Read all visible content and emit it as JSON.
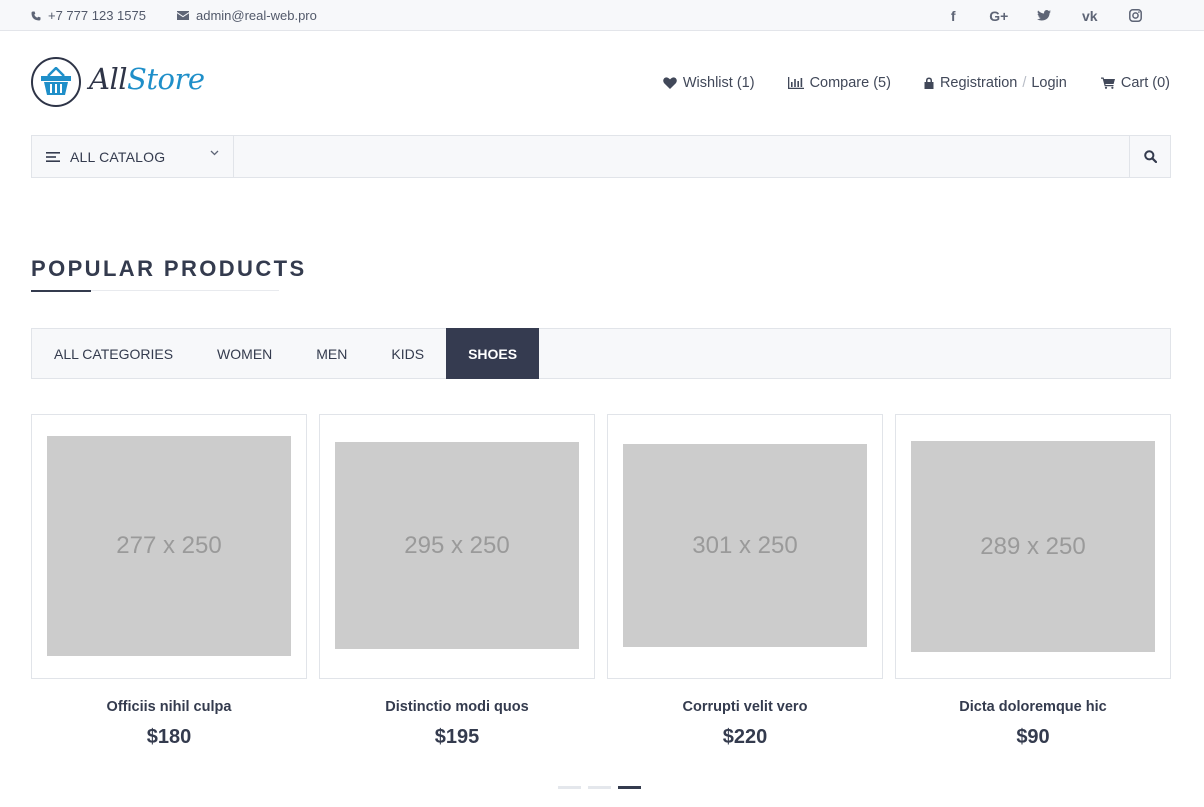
{
  "topbar": {
    "phone": "+7 777 123 1575",
    "email": "admin@real-web.pro",
    "socials": [
      {
        "icon": "facebook-icon",
        "glyph": "f"
      },
      {
        "icon": "google-plus-icon",
        "glyph": "G+"
      },
      {
        "icon": "twitter-icon",
        "glyph": ""
      },
      {
        "icon": "vk-icon",
        "glyph": "vk"
      },
      {
        "icon": "instagram-icon",
        "glyph": ""
      }
    ]
  },
  "logo": {
    "part1": "All",
    "part2": "Store"
  },
  "nav": {
    "wishlist": "Wishlist (1)",
    "compare": "Compare (5)",
    "registration": "Registration",
    "separator": "/",
    "login": "Login",
    "cart": "Cart (0)"
  },
  "search": {
    "catalog_label": "ALL CATALOG",
    "placeholder": ""
  },
  "section": {
    "title": "POPULAR PRODUCTS"
  },
  "tabs": [
    {
      "label": "ALL CATEGORIES",
      "active": false
    },
    {
      "label": "WOMEN",
      "active": false
    },
    {
      "label": "MEN",
      "active": false
    },
    {
      "label": "KIDS",
      "active": false
    },
    {
      "label": "SHOES",
      "active": true
    }
  ],
  "products": [
    {
      "image_text": "277 x 250",
      "name": "Officiis nihil culpa",
      "price": "$180"
    },
    {
      "image_text": "295 x 250",
      "name": "Distinctio modi quos",
      "price": "$195"
    },
    {
      "image_text": "301 x 250",
      "name": "Corrupti velit vero",
      "price": "$220"
    },
    {
      "image_text": "289 x 250",
      "name": "Dicta doloremque hic",
      "price": "$90"
    }
  ],
  "pagination": {
    "active_page": 3,
    "pages": 3
  },
  "colors": {
    "accent": "#353b50",
    "logo_blue": "#1f8fc9",
    "placeholder": "#cccccc"
  }
}
